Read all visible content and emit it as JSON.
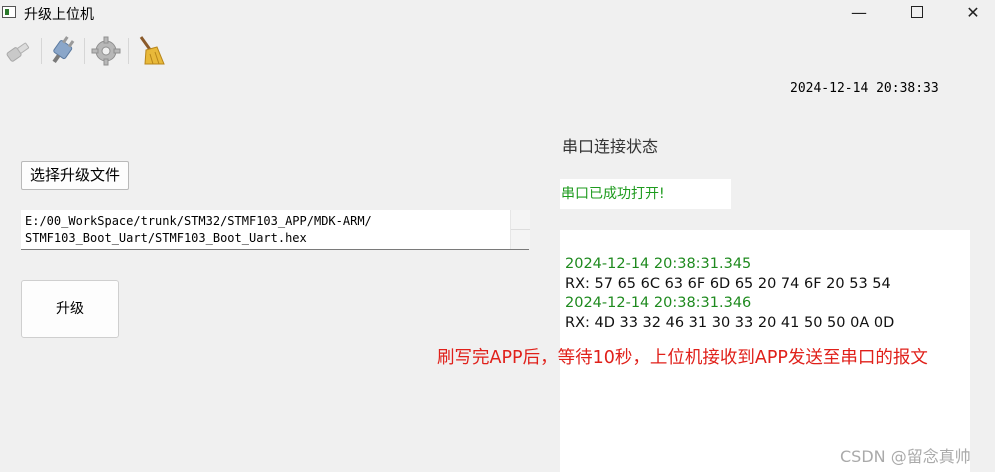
{
  "window": {
    "title": "升级上位机",
    "minimize_glyph": "—",
    "close_glyph": "✕"
  },
  "toolbar": {
    "items": [
      {
        "name": "connect-icon"
      },
      {
        "name": "plug-icon"
      },
      {
        "name": "settings-gear-icon"
      },
      {
        "name": "broom-clear-icon"
      }
    ]
  },
  "datetime": "2024-12-14 20:38:33",
  "file": {
    "select_button_label": "选择升级文件",
    "path": "E:/00_WorkSpace/trunk/STM32/STMF103_APP/MDK-ARM/\nSTMF103_Boot_Uart/STMF103_Boot_Uart.hex"
  },
  "upgrade_button_label": "升级",
  "serial": {
    "status_label": "串口连接状态",
    "status_value": "串口已成功打开!",
    "log": [
      {
        "timestamp": "2024-12-14 20:38:31.345",
        "rx": "RX: 57 65 6C 63 6F 6D 65 20 74 6F 20 53 54"
      },
      {
        "timestamp": "2024-12-14 20:38:31.346",
        "rx": "RX: 4D 33 32 46 31 30 33 20 41 50 50 0A 0D"
      }
    ]
  },
  "annotation": "刷写完APP后，等待10秒，上位机接收到APP发送至串口的报文",
  "watermark": "CSDN @留念真帅",
  "colors": {
    "status_green": "#1e9b1e",
    "timestamp_green": "#1e8a1e",
    "annotation_red": "#e0201a"
  }
}
